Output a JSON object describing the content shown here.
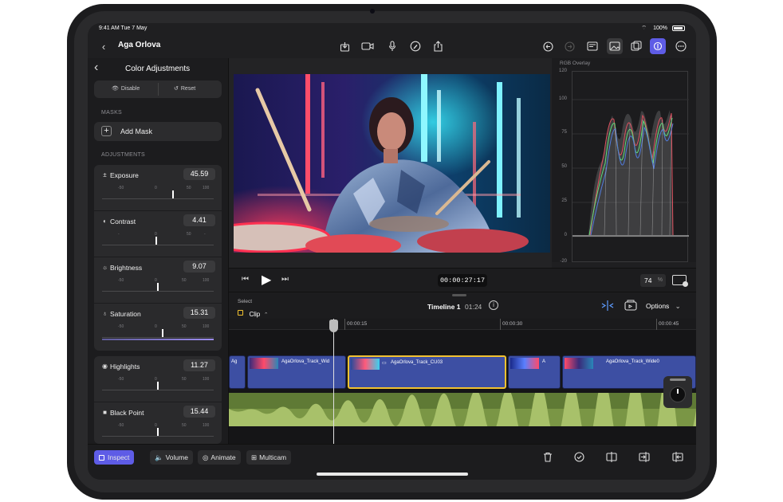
{
  "status": {
    "time": "9:41 AM",
    "date": "Tue 7 May",
    "battery": "100%"
  },
  "topbar": {
    "title": "Aga Orlova"
  },
  "panel": {
    "title": "Color Adjustments",
    "disable_label": "Disable",
    "reset_label": "Reset",
    "masks_section": "MASKS",
    "add_mask_label": "Add Mask",
    "adjustments_section": "ADJUSTMENTS",
    "items": [
      {
        "name": "Exposure",
        "value": "45.59",
        "icon": "plus-minus-icon",
        "ticks": [
          "-50",
          "0",
          "50",
          "100"
        ],
        "level": 0.62
      },
      {
        "name": "Contrast",
        "value": "4.41",
        "icon": "half-circle-icon",
        "ticks": [
          "-",
          "0",
          "50",
          "-"
        ],
        "level": 0.48
      },
      {
        "name": "Brightness",
        "value": "9.07",
        "icon": "sun-icon",
        "ticks": [
          "-50",
          "0",
          "50",
          "100"
        ],
        "level": 0.5
      },
      {
        "name": "Saturation",
        "value": "15.31",
        "icon": "drop-icon",
        "ticks": [
          "-50",
          "0",
          "50",
          "100"
        ],
        "level": 0.52
      },
      {
        "name": "Highlights",
        "value": "11.27",
        "icon": "target-icon",
        "ticks": [
          "-50",
          "0",
          "50",
          "100"
        ],
        "level": 0.53
      },
      {
        "name": "Black Point",
        "value": "15.44",
        "icon": "square-icon",
        "ticks": [
          "-50",
          "0",
          "50",
          "100"
        ],
        "level": 0.55
      }
    ]
  },
  "scope": {
    "title": "RGB Overlay",
    "axis": [
      "120",
      "100",
      "75",
      "50",
      "25",
      "0",
      "-20"
    ]
  },
  "transport": {
    "timecode": "00:00:27:17",
    "zoom": "74",
    "zoom_unit": "%"
  },
  "timeline": {
    "select_label": "Select",
    "clip_label": "Clip",
    "name": "Timeline 1",
    "duration": "01:24",
    "options_label": "Options",
    "ruler": [
      "00:00:15",
      "00:00:30",
      "00:00:45"
    ],
    "clips": [
      "Ag",
      "AgaOrlova_Track_Wid",
      "AgaOrlova_Track_CU03",
      "A",
      "AgaOrlova_Track_Wide0"
    ]
  },
  "bottom": {
    "inspect": "Inspect",
    "volume": "Volume",
    "animate": "Animate",
    "multicam": "Multicam"
  },
  "colors": {
    "accent": "#5e5ce6",
    "clip": "#3d4fa3",
    "audio": "#7a9645",
    "selected": "#f2c230"
  }
}
